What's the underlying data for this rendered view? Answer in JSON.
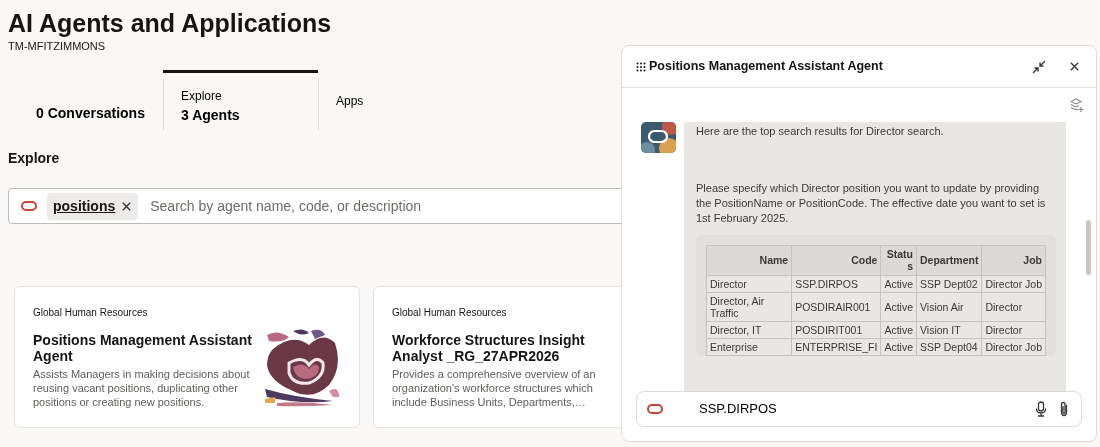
{
  "page": {
    "title": "AI Agents and Applications",
    "user": "TM-MFITZIMMONS"
  },
  "tabs": [
    {
      "label": "0 Conversations",
      "selected": false
    },
    {
      "caption": "Explore",
      "label": "3 Agents",
      "selected": true
    },
    {
      "caption": "Apps",
      "selected": false
    }
  ],
  "section_title": "Explore",
  "search": {
    "chip": "positions",
    "placeholder": "Search by agent name, code, or description"
  },
  "agent_cards": [
    {
      "kind": "illustrated",
      "category": "Global Human Resources",
      "title": "Positions Management Assistant Agent",
      "description": "Assists Managers in making decisions about reusing vacant positions, duplicating other positions or creating new positions."
    },
    {
      "kind": "plain",
      "category": "Global Human Resources",
      "title": "Workforce Structures Insight Analyst _RG_27APR2026",
      "description": "Provides a comprehensive overview of an organization's workforce structures which include Business Units, Departments,…"
    }
  ],
  "chat": {
    "title": "Positions Management Assistant Agent",
    "messages": [
      "Here are the top search results for Director search.",
      "Please specify which Director position you want to update by providing the PositionName or PositionCode. The effective date you want to set is 1st February 2025."
    ],
    "table": {
      "columns": [
        "Name",
        "Code",
        "Status",
        "Department",
        "Job"
      ],
      "rows": [
        [
          "Director",
          "SSP.DIRPOS",
          "Active",
          "SSP Dept02",
          "Director Job"
        ],
        [
          "Director, Air Traffic",
          "POSDIRAIR001",
          "Active",
          "Vision Air",
          "Director"
        ],
        [
          "Director, IT",
          "POSDIRIT001",
          "Active",
          "Vision IT",
          "Director"
        ],
        [
          "Enterprise",
          "ENTERPRISE_FI",
          "Active",
          "SSP Dept04",
          "Director Job"
        ]
      ]
    },
    "input": {
      "value": "SSP.DIRPOS"
    }
  }
}
